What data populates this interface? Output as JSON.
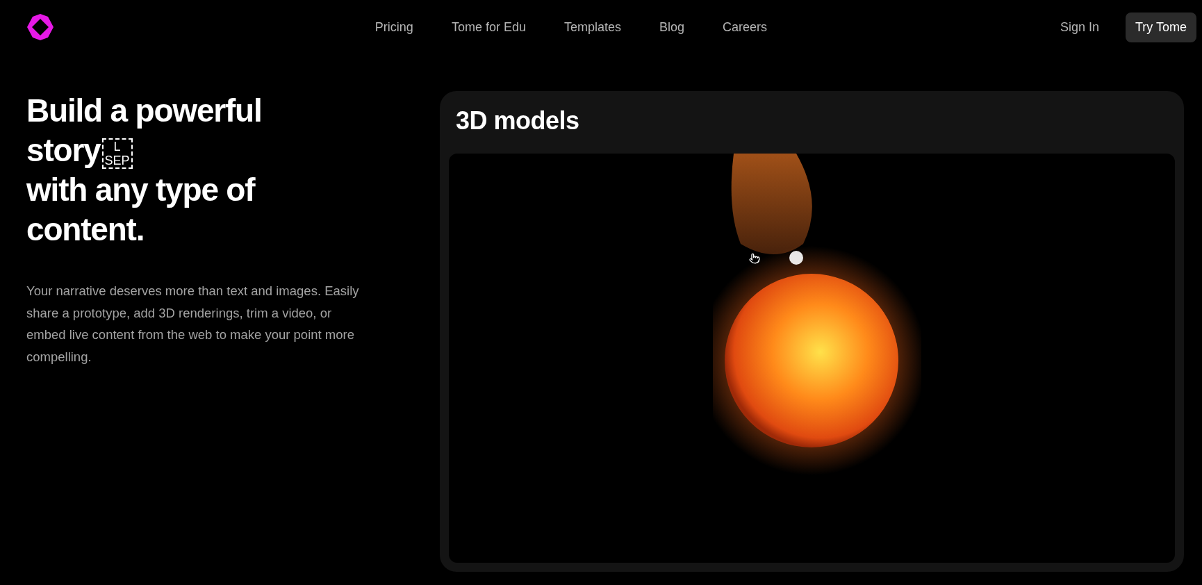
{
  "nav": {
    "links": [
      {
        "label": "Pricing"
      },
      {
        "label": "Tome for Edu"
      },
      {
        "label": "Templates"
      },
      {
        "label": "Blog"
      },
      {
        "label": "Careers"
      }
    ],
    "sign_in": "Sign In",
    "cta": "Try Tome"
  },
  "hero": {
    "headline": [
      {
        "text": "Build a powerful"
      },
      {
        "text": "story",
        "glyph": [
          "L",
          "SEP"
        ]
      },
      {
        "text": "with any type of"
      },
      {
        "text": "content."
      }
    ],
    "body": "Your narrative deserves more than text and images. Easily share a prototype, add 3D renderings, trim a video, or embed live content from the web to make your point more compelling."
  },
  "card": {
    "title": "3D models"
  }
}
